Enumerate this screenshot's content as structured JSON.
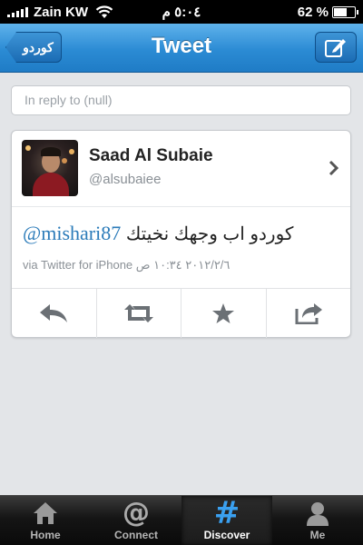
{
  "status_bar": {
    "carrier": "Zain KW",
    "time": "٥:٠٤ م",
    "battery": "62 %",
    "battery_level": 0.62
  },
  "nav": {
    "title": "Tweet",
    "back_label": "كوردو",
    "compose_icon": "compose-icon"
  },
  "reply": {
    "placeholder": "In reply to (null)"
  },
  "tweet": {
    "user_name": "Saad Al Subaie",
    "user_handle": "@alsubaiee",
    "mention": "@mishari87",
    "text": "كوردو اب وجهك نخيتك",
    "meta": "via Twitter for iPhone ٢٠١٢/٢/٦ ١٠:٣٤ ص",
    "actions": [
      "reply-icon",
      "retweet-icon",
      "favorite-icon",
      "share-icon"
    ]
  },
  "tabs": [
    {
      "label": "Home",
      "icon": "home-icon"
    },
    {
      "label": "Connect",
      "icon": "at-icon"
    },
    {
      "label": "Discover",
      "icon": "hash-icon",
      "active": true
    },
    {
      "label": "Me",
      "icon": "person-icon"
    }
  ],
  "colors": {
    "nav_blue": "#2b8bd4",
    "link_blue": "#2b7bb9",
    "discover_blue": "#3aa0f0"
  }
}
